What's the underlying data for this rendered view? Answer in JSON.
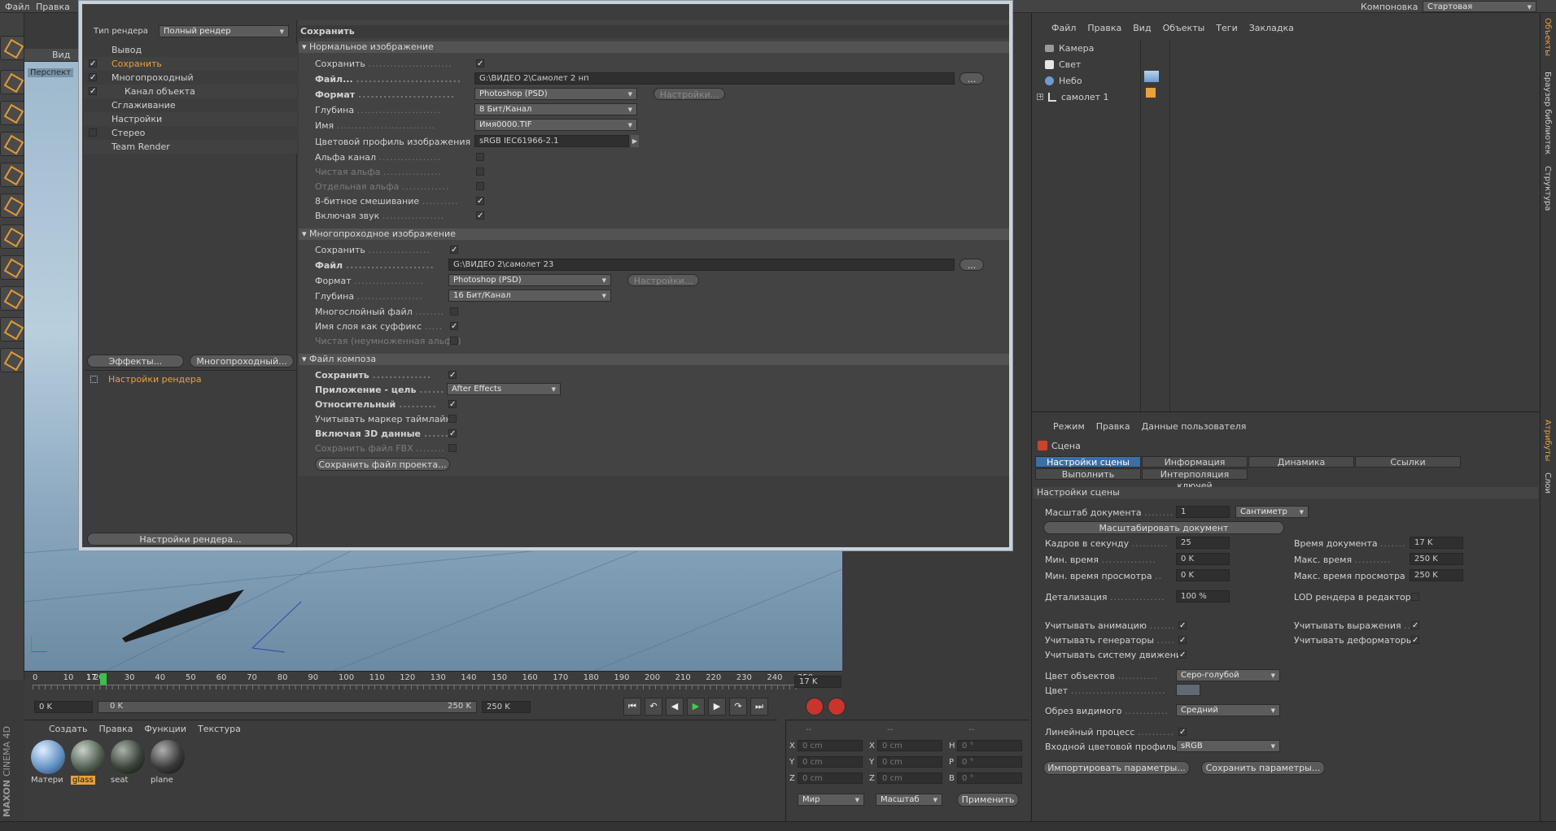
{
  "menu": {
    "file": "Файл",
    "edit": "Правка",
    "layout_label": "Компоновка",
    "layout_value": "Стартовая"
  },
  "viewport": {
    "menu_view": "Вид",
    "camera": "Перспект"
  },
  "render_dialog": {
    "render_type_label": "Тип рендера",
    "render_type_value": "Полный рендер",
    "tree": [
      "Вывод",
      "Сохранить",
      "Многопроходный",
      "Канал объекта",
      "Сглаживание",
      "Настройки",
      "Стерео",
      "Team Render"
    ],
    "effects_btn": "Эффекты...",
    "multipass_btn": "Многопроходный...",
    "preset_label": "Настройки рендера",
    "settings_btn": "Настройки рендера...",
    "panel_title": "Сохранить",
    "normal": {
      "header": "Нормальное изображение",
      "save": "Сохранить",
      "file": "Файл...",
      "file_value": "G:\\ВИДЕО 2\\Самолет 2 нп",
      "format": "Формат",
      "format_value": "Photoshop (PSD)",
      "options_btn": "Настройки...",
      "depth": "Глубина",
      "depth_value": "8 Бит/Канал",
      "name": "Имя",
      "name_value": "Имя0000.TIF",
      "profile": "Цветовой профиль изображения",
      "profile_value": "sRGB IEC61966-2.1",
      "alpha": "Альфа канал",
      "straight_alpha": "Чистая альфа",
      "separate_alpha": "Отдельная альфа",
      "dither": "8-битное смешивание",
      "sound": "Включая звук"
    },
    "multipass": {
      "header": "Многопроходное изображение",
      "save": "Сохранить",
      "file": "Файл",
      "file_value": "G:\\ВИДЕО 2\\самолет 23",
      "format": "Формат",
      "format_value": "Photoshop (PSD)",
      "options_btn": "Настройки...",
      "depth": "Глубина",
      "depth_value": "16 Бит/Канал",
      "layered": "Многослойный файл",
      "layer_suffix": "Имя слоя как суффикс",
      "straight": "Чистая (неумноженная альфа)"
    },
    "compositing": {
      "header": "Файл композа",
      "save": "Сохранить",
      "target_app": "Приложение - цель",
      "target_app_value": "After Effects",
      "relative": "Относительный",
      "timeline_marker": "Учитывать маркер таймлайна",
      "include_3d": "Включая 3D данные",
      "save_fbx": "Сохранить файл FBX",
      "save_project_btn": "Сохранить файл проекта..."
    }
  },
  "objects": {
    "menu": [
      "Файл",
      "Правка",
      "Вид",
      "Объекты",
      "Теги",
      "Закладка"
    ],
    "items": [
      "Камера",
      "Свет",
      "Небо",
      "самолет 1"
    ]
  },
  "side_tabs": {
    "objects": "Объекты",
    "browser": "Браузер библиотек",
    "structure": "Структура",
    "attributes": "Атрибуты",
    "layers": "Слои"
  },
  "attributes": {
    "menu": [
      "Режим",
      "Правка",
      "Данные пользователя"
    ],
    "title": "Сцена",
    "tabs": [
      "Настройки сцены",
      "Информация",
      "Динамика",
      "Ссылки",
      "Выполнить",
      "Интерполяция ключей"
    ],
    "section": "Настройки сцены",
    "doc_scale": "Масштаб документа",
    "doc_scale_value": "1",
    "doc_scale_unit": "Сантиметр",
    "scale_doc_btn": "Масштабировать документ",
    "fps": "Кадров в секунду",
    "fps_value": "25",
    "doc_time": "Время документа",
    "doc_time_value": "17 K",
    "min_time": "Мин. время",
    "min_time_value": "0 K",
    "max_time": "Макс. время",
    "max_time_value": "250 K",
    "min_preview": "Мин. время просмотра",
    "min_preview_value": "0 K",
    "max_preview": "Макс. время просмотра",
    "max_preview_value": "250 K",
    "lod": "Детализация",
    "lod_value": "100 %",
    "lod_render": "LOD рендера в редакторе",
    "use_anim": "Учитывать анимацию",
    "use_expr": "Учитывать выражения",
    "use_gen": "Учитывать генераторы",
    "use_deform": "Учитывать деформаторы",
    "use_motion": "Учитывать систему движения",
    "obj_color": "Цвет объектов",
    "obj_color_value": "Серо-голубой",
    "color": "Цвет",
    "clipping": "Обрез видимого",
    "clipping_value": "Средний",
    "linear": "Линейный процесс",
    "input_profile": "Входной цветовой профиль",
    "input_profile_value": "sRGB",
    "import_btn": "Импортировать параметры...",
    "save_btn": "Сохранить параметры..."
  },
  "timeline": {
    "ticks": [
      "0",
      "10",
      "20",
      "30",
      "40",
      "50",
      "60",
      "70",
      "80",
      "90",
      "100",
      "110",
      "120",
      "130",
      "140",
      "150",
      "160",
      "170",
      "180",
      "190",
      "200",
      "210",
      "220",
      "230",
      "240",
      "250"
    ],
    "current": "17",
    "frame_field": "17 K",
    "start": "0 K",
    "range_left": "0 K",
    "range_right": "250 K",
    "end": "250 K"
  },
  "materials": {
    "menu": [
      "Создать",
      "Правка",
      "Функции",
      "Текстура"
    ],
    "items": [
      "Матери",
      "glass",
      "seat",
      "plane"
    ]
  },
  "coords": {
    "header": [
      "--",
      "--",
      "--"
    ],
    "rows": [
      [
        "X",
        "0 cm",
        "X",
        "0 cm",
        "H",
        "0 °"
      ],
      [
        "Y",
        "0 cm",
        "Y",
        "0 cm",
        "P",
        "0 °"
      ],
      [
        "Z",
        "0 cm",
        "Z",
        "0 cm",
        "B",
        "0 °"
      ]
    ],
    "world": "Мир",
    "scale": "Масштаб",
    "apply": "Применить"
  },
  "brand": {
    "maxon": "MAXON",
    "product": "CINEMA 4D"
  },
  "colors": {
    "accent": "#e8a23a",
    "selected_tab": "#3d6ea8"
  }
}
